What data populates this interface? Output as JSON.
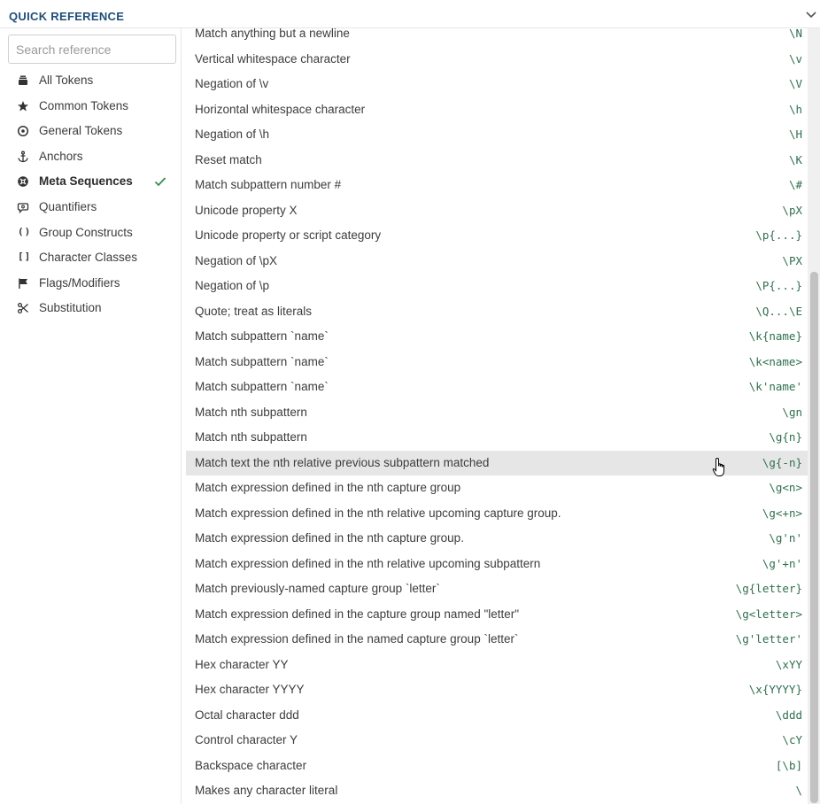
{
  "header": {
    "title": "QUICK REFERENCE",
    "toggle_icon": "chevron-down-icon"
  },
  "sidebar": {
    "search_placeholder": "Search reference",
    "categories": [
      {
        "label": "All Tokens",
        "icon": "stack-icon"
      },
      {
        "label": "Common Tokens",
        "icon": "star-icon"
      },
      {
        "label": "General Tokens",
        "icon": "target-icon"
      },
      {
        "label": "Anchors",
        "icon": "anchor-icon"
      },
      {
        "label": "Meta Sequences",
        "icon": "globe-icon",
        "active": true
      },
      {
        "label": "Quantifiers",
        "icon": "loop-icon"
      },
      {
        "label": "Group Constructs",
        "icon": "parentheses-icon",
        "glyph": "()"
      },
      {
        "label": "Character Classes",
        "icon": "brackets-icon",
        "glyph": "[]"
      },
      {
        "label": "Flags/Modifiers",
        "icon": "flag-icon"
      },
      {
        "label": "Substitution",
        "icon": "scissors-icon"
      }
    ],
    "active_check_icon": "checkmark-icon"
  },
  "rows": [
    {
      "desc": "Match anything but a newline",
      "token": "\\N"
    },
    {
      "desc": "Vertical whitespace character",
      "token": "\\v"
    },
    {
      "desc": "Negation of \\v",
      "token": "\\V"
    },
    {
      "desc": "Horizontal whitespace character",
      "token": "\\h"
    },
    {
      "desc": "Negation of \\h",
      "token": "\\H"
    },
    {
      "desc": "Reset match",
      "token": "\\K"
    },
    {
      "desc": "Match subpattern number #",
      "token": "\\#"
    },
    {
      "desc": "Unicode property X",
      "token": "\\pX"
    },
    {
      "desc": "Unicode property or script category",
      "token": "\\p{...}"
    },
    {
      "desc": "Negation of \\pX",
      "token": "\\PX"
    },
    {
      "desc": "Negation of \\p",
      "token": "\\P{...}"
    },
    {
      "desc": "Quote; treat as literals",
      "token": "\\Q...\\E"
    },
    {
      "desc": "Match subpattern `name`",
      "token": "\\k{name}"
    },
    {
      "desc": "Match subpattern `name`",
      "token": "\\k<name>"
    },
    {
      "desc": "Match subpattern `name`",
      "token": "\\k'name'"
    },
    {
      "desc": "Match nth subpattern",
      "token": "\\gn"
    },
    {
      "desc": "Match nth subpattern",
      "token": "\\g{n}"
    },
    {
      "desc": "Match text the nth relative previous subpattern matched",
      "token": "\\g{-n}",
      "hover": true
    },
    {
      "desc": "Match expression defined in the nth capture group",
      "token": "\\g<n>"
    },
    {
      "desc": "Match expression defined in the nth relative upcoming capture group.",
      "token": "\\g<+n>"
    },
    {
      "desc": "Match expression defined in the nth capture group.",
      "token": "\\g'n'"
    },
    {
      "desc": "Match expression defined in the nth relative upcoming subpattern",
      "token": "\\g'+n'"
    },
    {
      "desc": "Match previously-named capture group `letter`",
      "token": "\\g{letter}"
    },
    {
      "desc": "Match expression defined in the capture group named \"letter\"",
      "token": "\\g<letter>"
    },
    {
      "desc": "Match expression defined in the named capture group `letter`",
      "token": "\\g'letter'"
    },
    {
      "desc": "Hex character YY",
      "token": "\\xYY"
    },
    {
      "desc": "Hex character YYYY",
      "token": "\\x{YYYY}"
    },
    {
      "desc": "Octal character ddd",
      "token": "\\ddd"
    },
    {
      "desc": "Control character Y",
      "token": "\\cY"
    },
    {
      "desc": "Backspace character",
      "token": "[\\b]"
    },
    {
      "desc": "Makes any character literal",
      "token": "\\"
    }
  ],
  "colors": {
    "accent": "#1f4e79",
    "token": "#2f6f4f",
    "check": "#3a8a4f",
    "hover_row": "#e6e6e6"
  }
}
